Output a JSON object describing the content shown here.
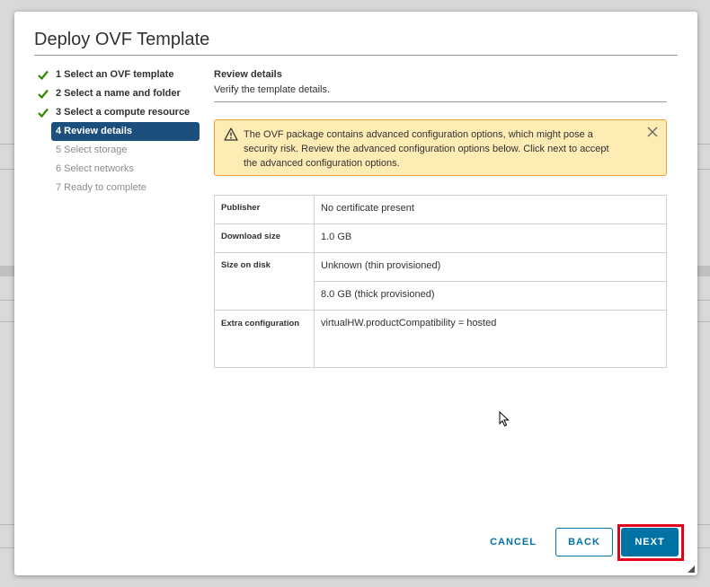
{
  "dialog": {
    "title": "Deploy OVF Template",
    "steps": [
      {
        "label": "1 Select an OVF template",
        "state": "done"
      },
      {
        "label": "2 Select a name and folder",
        "state": "done"
      },
      {
        "label": "3 Select a compute resource",
        "state": "done"
      },
      {
        "label": "4 Review details",
        "state": "active"
      },
      {
        "label": "5 Select storage",
        "state": "todo"
      },
      {
        "label": "6 Select networks",
        "state": "todo"
      },
      {
        "label": "7 Ready to complete",
        "state": "todo"
      }
    ],
    "section": {
      "title": "Review details",
      "subtitle": "Verify the template details."
    },
    "alert": {
      "icon": "warning-icon",
      "text": "The OVF package contains advanced configuration options, which might pose a security risk. Review the advanced configuration options below. Click next to accept the advanced configuration options."
    },
    "details": {
      "publisher_label": "Publisher",
      "publisher_value": "No certificate present",
      "download_label": "Download size",
      "download_value": "1.0 GB",
      "disk_label": "Size on disk",
      "disk_value_thin": "Unknown (thin provisioned)",
      "disk_value_thick": "8.0 GB (thick provisioned)",
      "extra_label": "Extra configuration",
      "extra_value": "virtualHW.productCompatibility = hosted"
    },
    "buttons": {
      "cancel": "CANCEL",
      "back": "BACK",
      "next": "NEXT"
    }
  },
  "colors": {
    "accent": "#0072a3",
    "active_step": "#1c4f7d",
    "alert_bg": "#feecb5",
    "alert_border": "#eb9f3e",
    "check": "#318700",
    "highlight": "#e3001b"
  }
}
